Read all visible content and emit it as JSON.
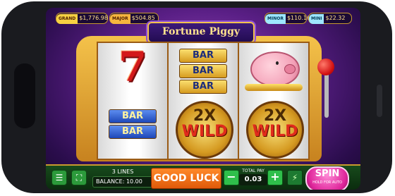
{
  "jackpots": {
    "grand": {
      "tag": "GRAND",
      "value": "$1,776.98"
    },
    "major": {
      "tag": "MAJOR",
      "value": "$504.85"
    },
    "minor": {
      "tag": "MINOR",
      "value": "$110.16"
    },
    "mini": {
      "tag": "MINI",
      "value": "$22.32"
    }
  },
  "game": {
    "title": "Fortune Piggy"
  },
  "reels": {
    "reel1": {
      "top": "7",
      "bar1": "BAR",
      "bar2": "BAR"
    },
    "reel2": {
      "bars": [
        "BAR",
        "BAR",
        "BAR"
      ],
      "wild_mult": "2X",
      "wild": "WILD"
    },
    "reel3": {
      "wild_mult": "2X",
      "wild": "WILD"
    }
  },
  "bottom_bar": {
    "lines_value": "3",
    "lines_label": "LINES",
    "balance_label": "BALANCE:",
    "balance_value": "10.00",
    "status": "GOOD LUCK",
    "total_pay_label": "TOTAL PAY",
    "total_pay_value": "0.03",
    "minus": "−",
    "plus": "+",
    "spin": "SPIN",
    "spin_hint": "HOLD FOR AUTO"
  },
  "colors": {
    "accent": "#f2c14e",
    "spin": "#e0289c",
    "bottom_bar": "#174a1c"
  },
  "icons": [
    "menu-icon",
    "paytable-icon",
    "turbo-icon"
  ]
}
